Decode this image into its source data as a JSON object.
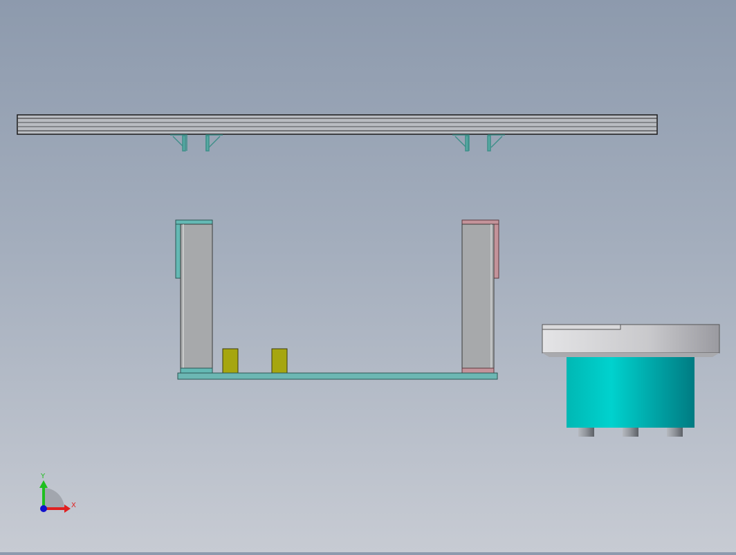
{
  "viewport": {
    "background_top": "#8d9aad",
    "background_bottom": "#c7cbd3"
  },
  "colors": {
    "rail_fill": "#b9bcc1",
    "rail_outline": "#1a1a1a",
    "bracket": "#4aa39c",
    "panel_gray": "#a7a9ab",
    "frame_left": "#64b9b4",
    "frame_right": "#c4939a",
    "base_plate": "#6cb7b3",
    "yellow_block": "#a6a60f",
    "cylinder": "#00c6c2",
    "disc": "#d6d6d8",
    "foot": "#8f9399"
  },
  "triad": {
    "x_label": "X",
    "y_label": "Y",
    "x_color": "#e02020",
    "y_color": "#1fbf1f",
    "origin_color": "#1010cc"
  }
}
